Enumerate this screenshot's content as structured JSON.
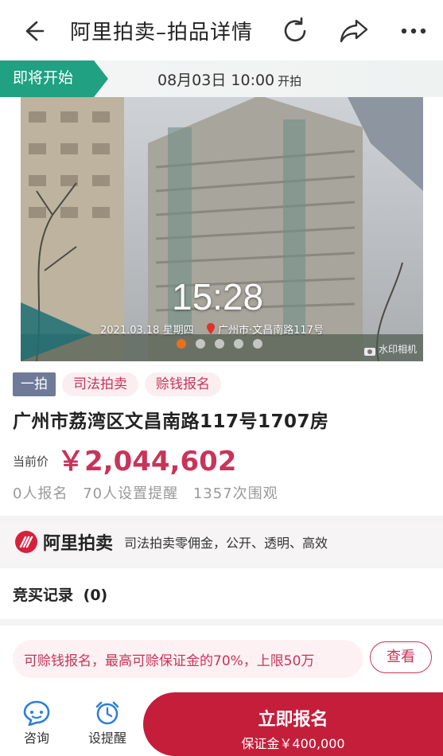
{
  "header": {
    "title": "阿里拍卖–拍品详情",
    "icons": [
      "back-arrow-icon",
      "refresh-icon",
      "share-icon",
      "more-icon"
    ]
  },
  "auction_status": {
    "badge": "即将开始",
    "start_time": "08月03日 10:00",
    "start_suffix": "开拍"
  },
  "photo": {
    "clock": "15:28",
    "caption": "2021.03.18 星期四",
    "location": "广州市·文昌南路117号",
    "watermark": "水印相机",
    "carousel_total": 5,
    "carousel_active": 1
  },
  "tags": [
    "一拍",
    "司法拍卖",
    "赊钱报名"
  ],
  "item": {
    "address": "广州市荔湾区文昌南路117号1707房",
    "price_label": "当前价",
    "price": "￥2,044,602",
    "stats": [
      "0人报名",
      "70人设置提醒",
      "1357次围观"
    ]
  },
  "banner": {
    "brand": "阿里拍卖",
    "text": "司法拍卖零佣金，公开、透明、高效"
  },
  "records": {
    "label": "竞买记录",
    "count": "(0)"
  },
  "promo": {
    "text": "可赊钱报名，最高可赊保证金的70%，上限50万",
    "button": "查看"
  },
  "bottom_bar": {
    "consult": "咨询",
    "remind": "设提醒",
    "signup": "立即报名",
    "deposit": "保证金￥400,000"
  },
  "colors": {
    "accent": "#c8345a",
    "signup_bg": "#c51e3a",
    "status_green": "#1fa182",
    "tag_grey": "#6f7a99",
    "icon_blue": "#2f7fd6"
  }
}
